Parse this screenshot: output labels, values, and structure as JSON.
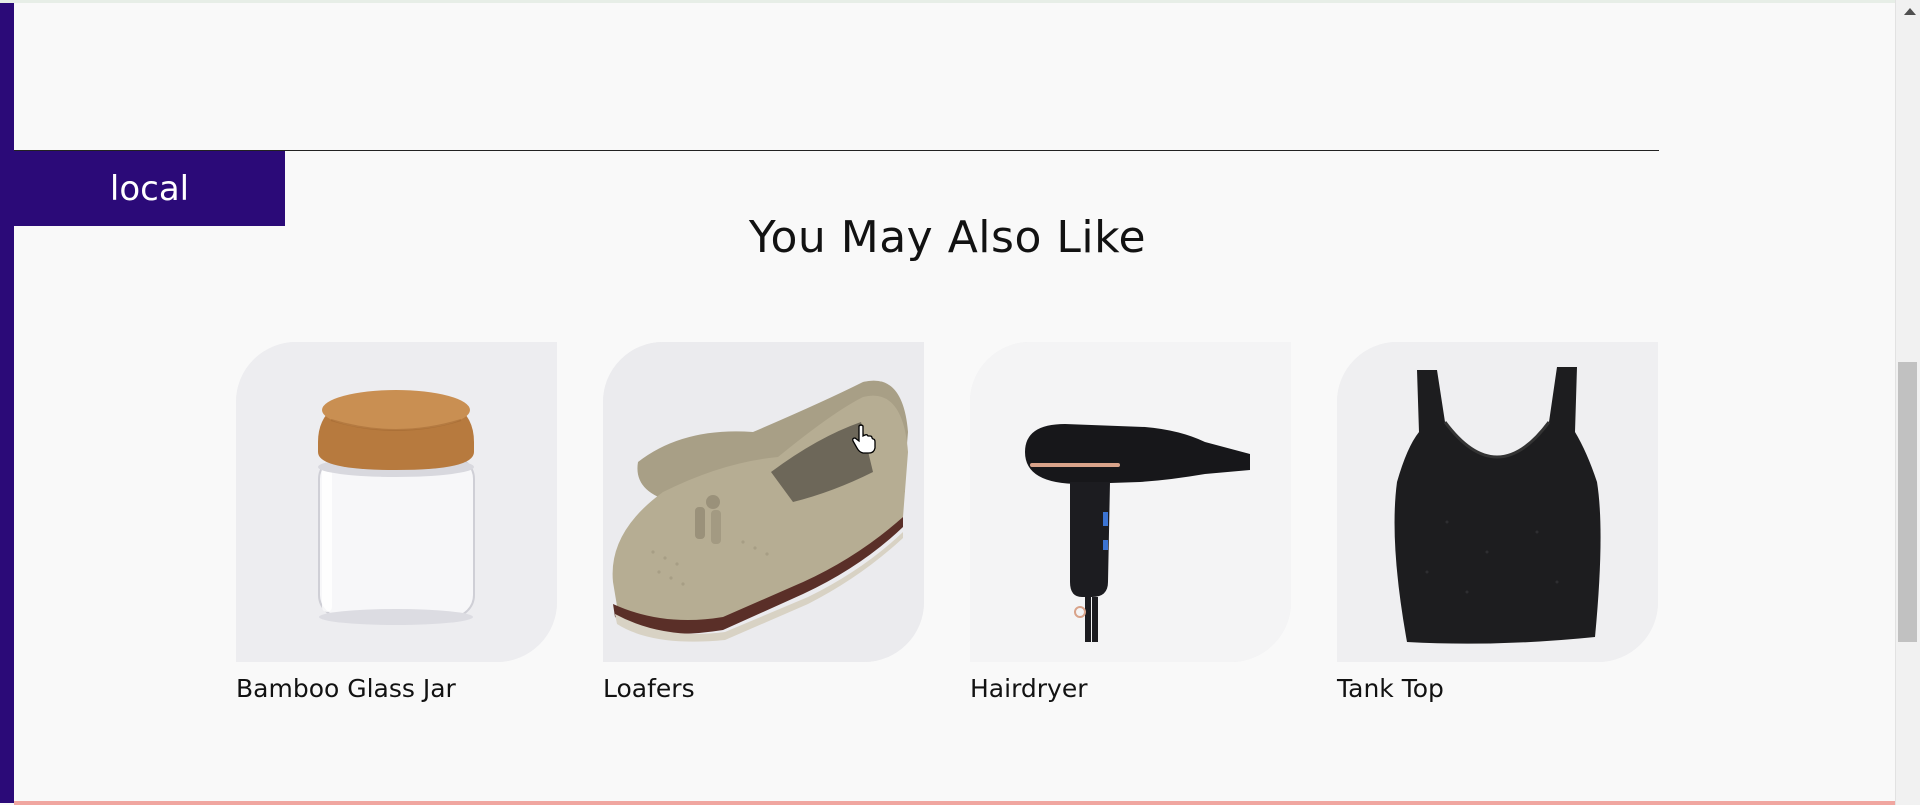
{
  "environment_badge": {
    "label": "local"
  },
  "recommendations": {
    "title": "You May Also Like",
    "products": [
      {
        "name": "Bamboo Glass Jar",
        "image": "bamboo-glass-jar-image"
      },
      {
        "name": "Loafers",
        "image": "loafers-image"
      },
      {
        "name": "Hairdryer",
        "image": "hairdryer-image"
      },
      {
        "name": "Tank Top",
        "image": "tank-top-image"
      }
    ]
  },
  "colors": {
    "environment": "#2b0a78",
    "background": "#f9f9f9",
    "text": "#121212",
    "footer_accent": "#f0a6a0"
  }
}
